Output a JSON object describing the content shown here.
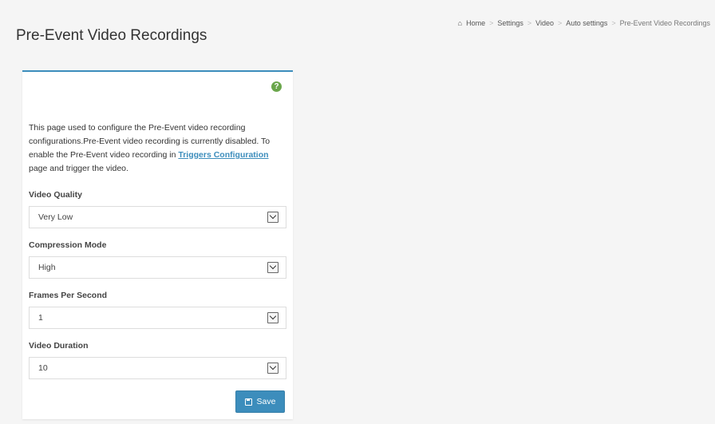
{
  "page": {
    "title": "Pre-Event Video Recordings"
  },
  "breadcrumb": {
    "items": [
      "Home",
      "Settings",
      "Video",
      "Auto settings",
      "Pre-Event Video Recordings"
    ],
    "separator": ">"
  },
  "help": {
    "icon": "question-circle-icon",
    "glyph": "?"
  },
  "description": {
    "text_before": "This page used to configure the Pre-Event video recording configurations.Pre-Event video recording is currently disabled. To enable the Pre-Event video recording in ",
    "link": "Triggers Configuration",
    "text_after": " page and trigger the video."
  },
  "fields": [
    {
      "label": "Video Quality",
      "value": "Very Low"
    },
    {
      "label": "Compression Mode",
      "value": "High"
    },
    {
      "label": "Frames Per Second",
      "value": "1"
    },
    {
      "label": "Video Duration",
      "value": "10"
    }
  ],
  "save": {
    "label": "Save",
    "icon": "floppy-disk-icon"
  },
  "colors": {
    "accent": "#3c8dbc",
    "help": "#6aa64b"
  }
}
